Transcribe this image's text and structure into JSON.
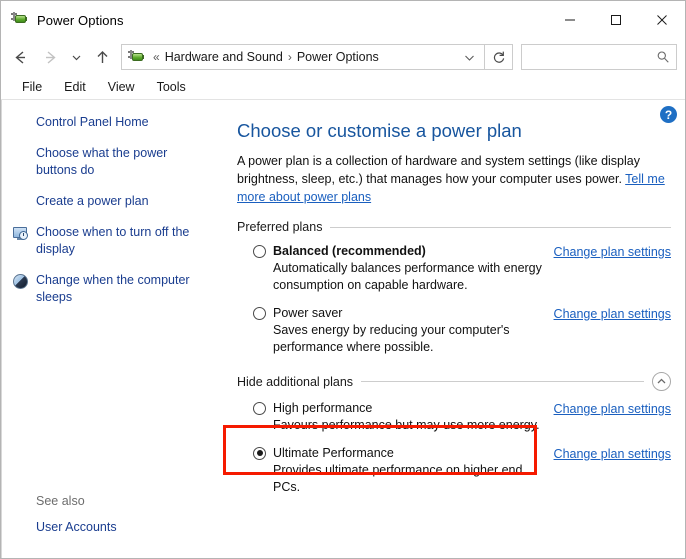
{
  "window": {
    "title": "Power Options",
    "app_icon": "power-plug-icon",
    "controls": {
      "minimize": "minimize",
      "maximize": "maximize",
      "close": "close"
    }
  },
  "navbar": {
    "back": "back-arrow",
    "forward": "forward-arrow",
    "recent": "recent-pages-chevron",
    "up": "up-arrow",
    "breadcrumb_icon": "power-plug-icon",
    "breadcrumb_overflow": "«",
    "breadcrumb": [
      "Hardware and Sound",
      "Power Options"
    ],
    "breadcrumb_separator": "›",
    "dropdown": "chevron-down",
    "refresh": "refresh",
    "search": {
      "value": "",
      "placeholder": "",
      "icon": "search-icon"
    }
  },
  "menubar": {
    "items": [
      "File",
      "Edit",
      "View",
      "Tools"
    ]
  },
  "sidebar": {
    "items": [
      {
        "label": "Control Panel Home",
        "icon": null
      },
      {
        "label": "Choose what the power buttons do",
        "icon": null
      },
      {
        "label": "Create a power plan",
        "icon": null
      },
      {
        "label": "Choose when to turn off the display",
        "icon": "display-clock-icon"
      },
      {
        "label": "Change when the computer sleeps",
        "icon": "moon-sleep-icon"
      }
    ],
    "see_also": {
      "title": "See also",
      "links": [
        "User Accounts"
      ]
    }
  },
  "main": {
    "help_icon": "?",
    "title": "Choose or customise a power plan",
    "description_before": "A power plan is a collection of hardware and system settings (like display brightness, sleep, etc.) that manages how your computer uses power. ",
    "description_link": "Tell me more about power plans",
    "groups": [
      {
        "label": "Preferred plans",
        "collapse_icon": null,
        "plans": [
          {
            "name": "Balanced (recommended)",
            "bold": true,
            "selected": false,
            "description": "Automatically balances performance with energy consumption on capable hardware.",
            "link": "Change plan settings",
            "highlighted": false
          },
          {
            "name": "Power saver",
            "bold": false,
            "selected": false,
            "description": "Saves energy by reducing your computer's performance where possible.",
            "link": "Change plan settings",
            "highlighted": false
          }
        ]
      },
      {
        "label": "Hide additional plans",
        "collapse_icon": "chevron-up-circle",
        "plans": [
          {
            "name": "High performance",
            "bold": false,
            "selected": false,
            "description": "Favours performance but may use more energy.",
            "link": "Change plan settings",
            "highlighted": false
          },
          {
            "name": "Ultimate Performance",
            "bold": false,
            "selected": true,
            "description": "Provides ultimate performance on higher end PCs.",
            "link": "Change plan settings",
            "highlighted": true
          }
        ]
      }
    ]
  },
  "colors": {
    "link": "#1a5fbf",
    "title": "#17559e",
    "sidebar_link": "#1a3d8f",
    "highlight_box": "#f51a00",
    "help_badge": "#1f6fc4"
  }
}
